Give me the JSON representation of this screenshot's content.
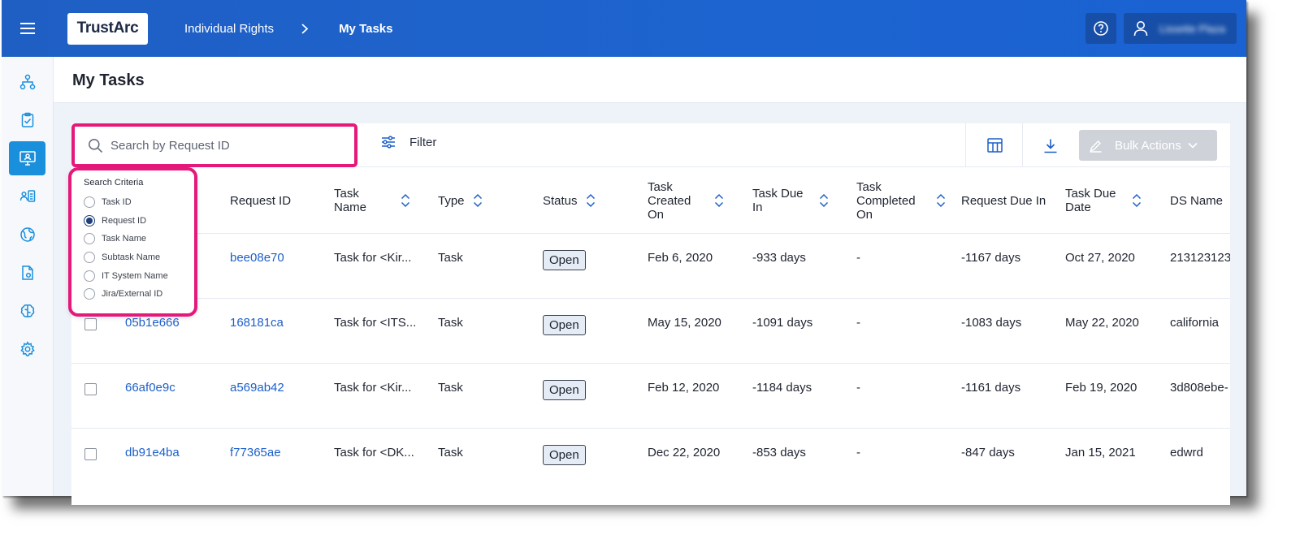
{
  "header": {
    "logo_text": "TrustArc",
    "breadcrumb": [
      "Individual Rights",
      "My Tasks"
    ],
    "user_name": "Lissette Plaza"
  },
  "page": {
    "title": "My Tasks"
  },
  "toolbar": {
    "search_placeholder": "Search by Request ID",
    "filter_label": "Filter",
    "bulk_actions_label": "Bulk Actions"
  },
  "search_criteria": {
    "title": "Search Criteria",
    "options": [
      "Task ID",
      "Request ID",
      "Task Name",
      "Subtask Name",
      "IT System Name",
      "Jira/External ID"
    ],
    "selected": "Request ID"
  },
  "table": {
    "columns": {
      "request_id": "Request ID",
      "task_name": "Task Name",
      "type": "Type",
      "status": "Status",
      "task_created_on": "Task Created On",
      "task_due_in": "Task Due In",
      "task_completed_on": "Task Completed On",
      "request_due_in": "Request Due In",
      "task_due_date": "Task Due Date",
      "ds_name": "DS Name"
    },
    "rows": [
      {
        "task_id": "",
        "request_id": "bee08e70",
        "task_name": "Task for <Kir...",
        "type": "Task",
        "status": "Open",
        "created_on": "Feb 6, 2020",
        "due_in": "-933 days",
        "completed_on": "-",
        "request_due_in": "-1167 days",
        "due_date": "Oct 27, 2020",
        "ds_name": "213123123"
      },
      {
        "task_id": "05b1e666",
        "request_id": "168181ca",
        "task_name": "Task for <ITS...",
        "type": "Task",
        "status": "Open",
        "created_on": "May 15, 2020",
        "due_in": "-1091 days",
        "completed_on": "-",
        "request_due_in": "-1083 days",
        "due_date": "May 22, 2020",
        "ds_name": "california"
      },
      {
        "task_id": "66af0e9c",
        "request_id": "a569ab42",
        "task_name": "Task for <Kir...",
        "type": "Task",
        "status": "Open",
        "created_on": "Feb 12, 2020",
        "due_in": "-1184 days",
        "completed_on": "-",
        "request_due_in": "-1161 days",
        "due_date": "Feb 19, 2020",
        "ds_name": "3d808ebe-"
      },
      {
        "task_id": "db91e4ba",
        "request_id": "f77365ae",
        "task_name": "Task for <DK...",
        "type": "Task",
        "status": "Open",
        "created_on": "Dec 22, 2020",
        "due_in": "-853 days",
        "completed_on": "-",
        "request_due_in": "-847 days",
        "due_date": "Jan 15, 2021",
        "ds_name": "edwrd"
      }
    ]
  }
}
